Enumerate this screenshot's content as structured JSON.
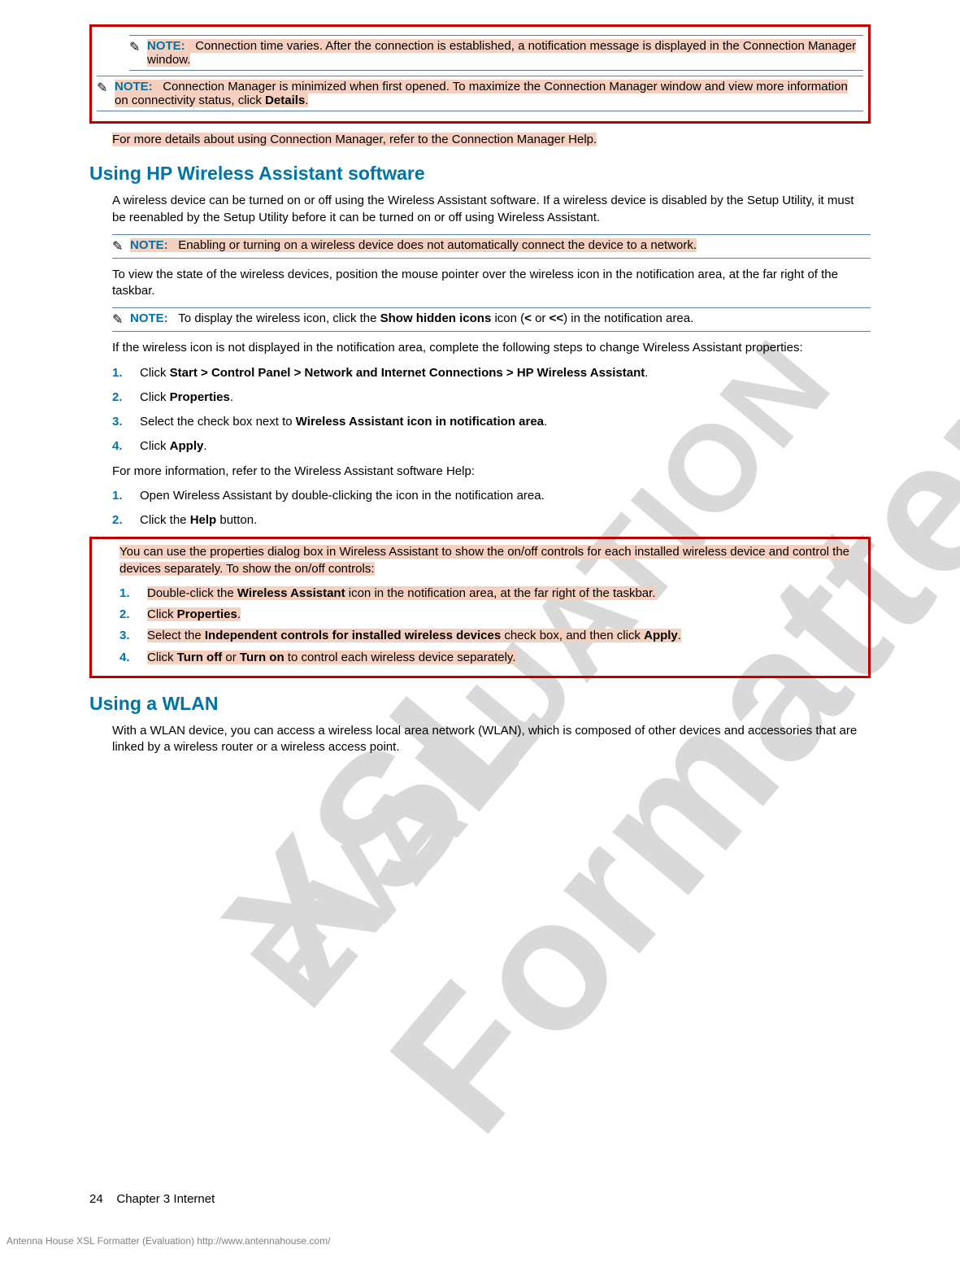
{
  "watermark1": "XSL Formatter",
  "watermark2": "EVALUATION",
  "note1": {
    "label": "NOTE:",
    "text": "Connection time varies. After the connection is established, a notification message is displayed in the Connection Manager window."
  },
  "note2": {
    "label": "NOTE:",
    "text_a": "Connection Manager is minimized when first opened. To maximize the Connection Manager window and view more information on connectivity status, click ",
    "bold": "Details",
    "text_b": "."
  },
  "para_more_details": "For more details about using Connection Manager, refer to the Connection Manager Help.",
  "h1": "Using HP Wireless Assistant software",
  "para_wa_intro": "A wireless device can be turned on or off using the Wireless Assistant software. If a wireless device is disabled by the Setup Utility, it must be reenabled by the Setup Utility before it can be turned on or off using Wireless Assistant.",
  "note3": {
    "label": "NOTE:",
    "text": "Enabling or turning on a wireless device does not automatically connect the device to a network."
  },
  "para_view_state": "To view the state of the wireless devices, position the mouse pointer over the wireless icon in the notification area, at the far right of the taskbar.",
  "note4": {
    "label": "NOTE:",
    "text_a": "To display the wireless icon, click the ",
    "bold1": "Show hidden icons",
    "text_b": " icon (",
    "bold2": "<",
    "text_c": " or ",
    "bold3": "<<",
    "text_d": ") in the notification area."
  },
  "para_if_not_displayed": "If the wireless icon is not displayed in the notification area, complete the following steps to change Wireless Assistant properties:",
  "steps1": {
    "s1_a": "Click ",
    "s1_b": "Start > Control Panel > Network and Internet Connections > HP Wireless Assistant",
    "s1_c": ".",
    "s2_a": "Click ",
    "s2_b": "Properties",
    "s2_c": ".",
    "s3_a": "Select the check box next to ",
    "s3_b": "Wireless Assistant icon in notification area",
    "s3_c": ".",
    "s4_a": "Click ",
    "s4_b": "Apply",
    "s4_c": "."
  },
  "para_more_info": "For more information, refer to the Wireless Assistant software Help:",
  "steps2": {
    "s1": "Open Wireless Assistant by double-clicking the icon in the notification area.",
    "s2_a": "Click the ",
    "s2_b": "Help",
    "s2_c": " button."
  },
  "para_props_dialog": "You can use the properties dialog box in Wireless Assistant to show the on/off controls for each installed wireless device and control the devices separately. To show the on/off controls:",
  "steps3": {
    "s1_a": "Double-click the ",
    "s1_b": "Wireless Assistant",
    "s1_c": " icon in the notification area, at the far right of the taskbar.",
    "s2_a": "Click ",
    "s2_b": "Properties",
    "s2_c": ".",
    "s3_a": "Select the ",
    "s3_b": "Independent controls for installed wireless devices",
    "s3_c": " check box, and then click ",
    "s3_d": "Apply",
    "s3_e": ".",
    "s4_a": "Click ",
    "s4_b": "Turn off",
    "s4_c": " or ",
    "s4_d": "Turn on",
    "s4_e": " to control each wireless device separately."
  },
  "h2": "Using a WLAN",
  "para_wlan": "With a WLAN device, you can access a wireless local area network (WLAN), which is composed of other devices and accessories that are linked by a wireless router or a wireless access point.",
  "footer": {
    "page_num": "24",
    "chapter": "Chapter 3   Internet"
  },
  "eval": "Antenna House XSL Formatter (Evaluation)  http://www.antennahouse.com/"
}
